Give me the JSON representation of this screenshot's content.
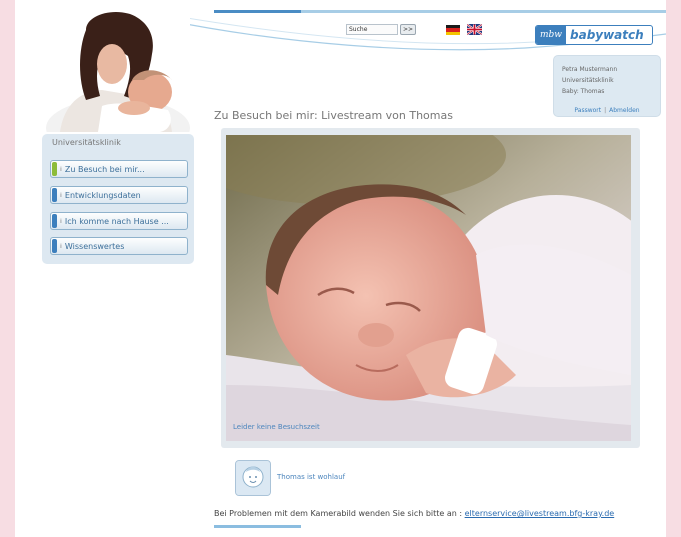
{
  "colors": {
    "background": "#f7dde3",
    "accent": "#3c7fbd",
    "nav_bg": "#dde8f1",
    "active_pill": "#8cbc3a",
    "inactive_pill": "#3c7fbd"
  },
  "header": {
    "search_placeholder": "Suche",
    "search_button": ">>",
    "languages": [
      "de-flag-icon",
      "en-flag-icon"
    ],
    "logo": {
      "prefix": "mbw",
      "name": "babywatch"
    }
  },
  "user": {
    "name": "Petra Mustermann",
    "clinic": "Universitätsklinik",
    "baby": "Baby: Thomas",
    "password_link": "Passwort",
    "separator": "|",
    "logout_link": "Abmelden"
  },
  "page_title": "Zu Besuch bei mir: Livestream von Thomas",
  "sidebar": {
    "heading": "Universitätsklinik",
    "items": [
      {
        "label": "Zu Besuch bei mir...",
        "active": true
      },
      {
        "label": "Entwicklungsdaten",
        "active": false
      },
      {
        "label": "Ich komme nach Hause ...",
        "active": false
      },
      {
        "label": "Wissenswertes",
        "active": false
      }
    ]
  },
  "stream": {
    "caption": "Leider keine Besuchszeit"
  },
  "status": {
    "text": "Thomas ist wohlauf"
  },
  "footer": {
    "text": "Bei Problemen mit dem Kamerabild wenden Sie sich bitte an :",
    "email": "elternservice@livestream.bfg-kray.de"
  }
}
